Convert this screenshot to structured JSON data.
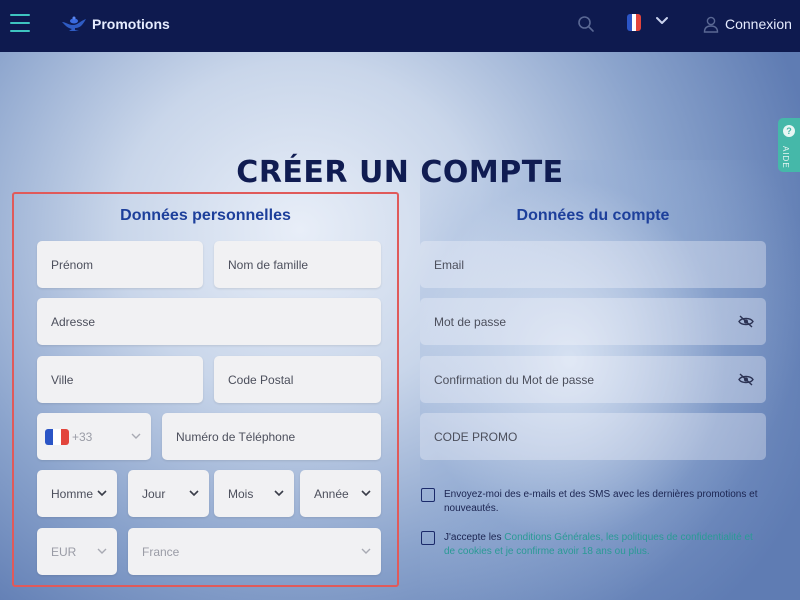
{
  "header": {
    "promotions_label": "Promotions",
    "login_label": "Connexion",
    "language_flag": "fr-flag-icon"
  },
  "help": {
    "label": "AIDE",
    "icon": "?"
  },
  "page_title": "CRÉER UN COMPTE",
  "personal": {
    "title": "Données personnelles",
    "first_name": "Prénom",
    "last_name": "Nom de famille",
    "address": "Adresse",
    "city": "Ville",
    "postal_code": "Code Postal",
    "phone_code": "+33",
    "phone_number": "Numéro de Téléphone",
    "gender": "Homme",
    "day": "Jour",
    "month": "Mois",
    "year": "Année",
    "currency": "EUR",
    "country": "France"
  },
  "account": {
    "title": "Données du compte",
    "email": "Email",
    "password": "Mot de passe",
    "confirm_password": "Confirmation du Mot de passe",
    "promo_code": "CODE PROMO"
  },
  "consents": {
    "marketing": "Envoyez-moi des e-mails et des SMS avec les dernières promotions et nouveautés.",
    "terms_prefix": "J'accepte les ",
    "terms_link": "Conditions Générales",
    "terms_sep": ", ",
    "privacy_link": "les politiques de confidentialité et de cookies",
    "terms_suffix": " et je confirme avoir 18 ans ou plus."
  },
  "colors": {
    "topbar": "#0e1a4f",
    "accent_teal": "#3ec5c1",
    "section_title": "#1d3f9b",
    "highlight_border": "#e05a5a"
  }
}
